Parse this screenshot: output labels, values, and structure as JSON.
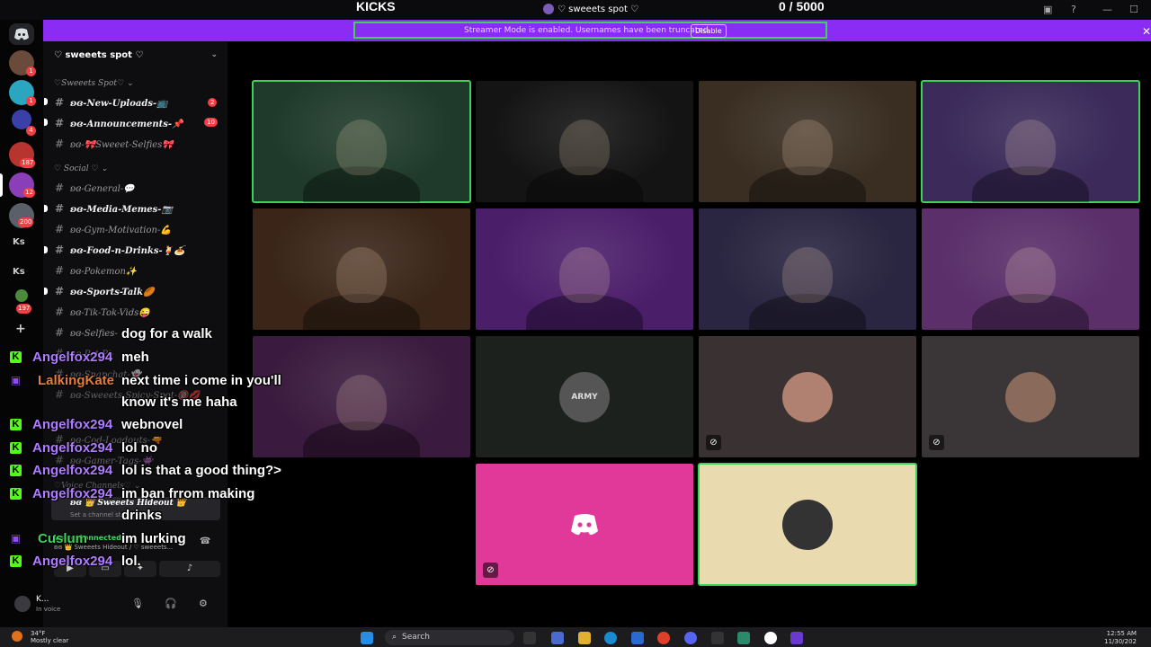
{
  "overlay": {
    "kicks_label": "KICKS",
    "kicks_count": "0   / 5000",
    "server_title": "♡ sweeets spot ♡"
  },
  "banner": {
    "message": "Streamer Mode is enabled. Usernames have been truncated.",
    "disable_label": "Disable",
    "color": "#8b2cf5"
  },
  "rail": {
    "badges": [
      "1",
      "1",
      "4",
      "187",
      "12",
      "200",
      "197"
    ],
    "text_items": [
      "Ks",
      "Ks"
    ],
    "add_icon": "+"
  },
  "sidebar": {
    "server_name": "♡ sweeets spot ♡",
    "categories": [
      "♡Sweeets Spot♡ ⌄",
      "♡ Social ♡ ⌄",
      "♡Voice Channels♡ ⌄"
    ],
    "channels": [
      {
        "label": "ʚɞ-New-Uploads-📺",
        "badge": "2"
      },
      {
        "label": "ʚɞ-Announcements-📌",
        "badge": "10"
      },
      {
        "label": "ʚɞ-🎀Sweeet-Selfies🎀"
      },
      {
        "label": "ʚɞ-General-💬"
      },
      {
        "label": "ʚɞ-Media-Memes-📷"
      },
      {
        "label": "ʚɞ-Gym-Motivation-💪"
      },
      {
        "label": "ʚɞ-Food-n-Drinks-🍹🍝"
      },
      {
        "label": "ʚɞ-Pokemon✨"
      },
      {
        "label": "ʚɞ-Sports-Talk🏉"
      },
      {
        "label": "ʚɞ-Tik-Tok-Vids😜"
      },
      {
        "label": "ʚɞ-Selfies-"
      },
      {
        "label": "ʚɞ-Pet-Pi-"
      },
      {
        "label": "ʚɞ-Snapchat-👻"
      },
      {
        "label": "ʚɞ-Sweeets-Spicy-Spot-🔞💋"
      },
      {
        "label": "ʚɞ-Cod-Loadouts-🔫"
      },
      {
        "label": "ʚɞ-Gamer-Tags-👾"
      }
    ],
    "voice_channel": {
      "name": "ʚɞ 👑 Sweeets Hideout 👑",
      "sub": "Set a channel st..."
    },
    "voice_status": {
      "title": "Voice Connected",
      "sub": "ʚɞ 👑 Sweeets Hideout / ♡ sweeets..."
    },
    "user": {
      "name": "K...",
      "status": "In voice"
    }
  },
  "chat": [
    {
      "platform": "",
      "user": "",
      "user_color": "#ffffff",
      "text": "dog for a walk"
    },
    {
      "platform": "kick",
      "user": "Angelfox294",
      "user_color": "#b07cff",
      "text": "meh"
    },
    {
      "platform": "twitch",
      "user": "LalkingKate",
      "user_color": "#e87c3c",
      "text": "next time i come in you'll"
    },
    {
      "platform": "",
      "user": "",
      "user_color": "#ffffff",
      "text": "know it's me haha"
    },
    {
      "platform": "kick",
      "user": "Angelfox294",
      "user_color": "#b07cff",
      "text": "webnovel"
    },
    {
      "platform": "kick",
      "user": "Angelfox294",
      "user_color": "#b07cff",
      "text": "lol no"
    },
    {
      "platform": "kick",
      "user": "Angelfox294",
      "user_color": "#b07cff",
      "text": "lol is that a good thing?>"
    },
    {
      "platform": "kick",
      "user": "Angelfox294",
      "user_color": "#b07cff",
      "text": "im ban frrom making"
    },
    {
      "platform": "",
      "user": "",
      "user_color": "#ffffff",
      "text": "drinks"
    },
    {
      "platform": "twitch",
      "user": "Cuslum",
      "user_color": "#3fd25a",
      "text": "im lurking"
    },
    {
      "platform": "kick",
      "user": "Angelfox294",
      "user_color": "#b07cff",
      "text": "lol."
    }
  ],
  "participants": [
    {
      "type": "video",
      "speaking": true,
      "bg": "#1f3a2a"
    },
    {
      "type": "video",
      "speaking": false,
      "bg": "#141414"
    },
    {
      "type": "video",
      "speaking": false,
      "bg": "#3a2e22"
    },
    {
      "type": "video",
      "speaking": true,
      "bg": "#3b2a5a"
    },
    {
      "type": "video",
      "speaking": false,
      "bg": "#3a2518"
    },
    {
      "type": "video",
      "speaking": false,
      "bg": "#4b1e6a"
    },
    {
      "type": "video",
      "speaking": false,
      "bg": "#2a2540"
    },
    {
      "type": "video",
      "speaking": false,
      "bg": "#5a2f6a"
    },
    {
      "type": "video",
      "speaking": false,
      "bg": "#3a1a3e"
    },
    {
      "type": "avatar",
      "speaking": false,
      "bg": "#1d211d",
      "avatar_color": "#555555",
      "avatar_text": "ARMY",
      "muted": false
    },
    {
      "type": "avatar",
      "speaking": false,
      "bg": "#3a3232",
      "avatar_color": "#b08070",
      "muted": true
    },
    {
      "type": "avatar",
      "speaking": false,
      "bg": "#3a3537",
      "avatar_color": "#8a6a5a",
      "muted": true
    },
    {
      "type": "discord",
      "speaking": false,
      "bg": "#e0399a",
      "muted": true
    },
    {
      "type": "avatar",
      "speaking": true,
      "bg": "#eadab0",
      "avatar_color": "#333333",
      "muted": false
    }
  ],
  "taskbar": {
    "weather_temp": "34°F",
    "weather_desc": "Mostly clear",
    "search_label": "Search",
    "time": "12:55 AM",
    "date": "11/30/202"
  }
}
